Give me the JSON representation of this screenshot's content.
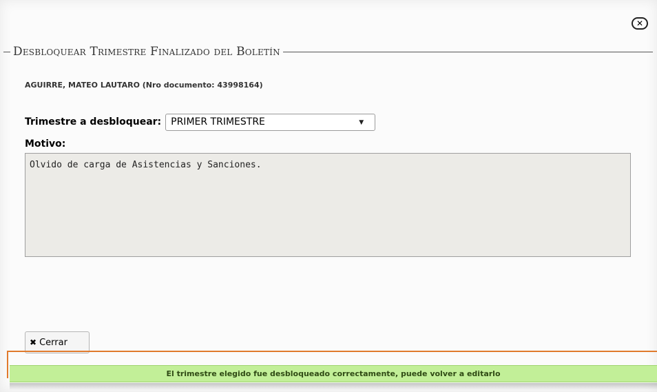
{
  "dialog": {
    "title": "Desbloquear Trimestre Finalizado del Boletín",
    "close_icon": "close-icon"
  },
  "student": {
    "info": "AGUIRRE, MATEO LAUTARO (Nro documento: 43998164)"
  },
  "form": {
    "trimestre_label": "Trimestre a desbloquear:",
    "trimestre_value": "PRIMER TRIMESTRE",
    "motivo_label": "Motivo:",
    "motivo_value": "Olvido de carga de Asistencias y Sanciones."
  },
  "actions": {
    "cerrar_label": "Cerrar",
    "cerrar_icon": "x-icon"
  },
  "notification": {
    "message": "El trimestre elegido fue desbloqueado correctamente, puede volver a editarlo",
    "color": "#c2ef98"
  }
}
